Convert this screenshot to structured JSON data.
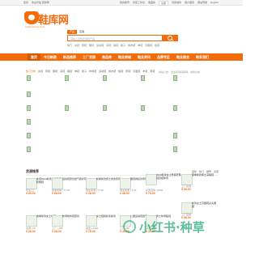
{
  "topbar": {
    "left": [
      "您好",
      "欢迎光临 鞋库网"
    ],
    "right": [
      "我的账号",
      "商家工作台",
      "收藏夹",
      "切换城市",
      "客户服务",
      "网站导航",
      "English"
    ],
    "location": "全国"
  },
  "logo": {
    "name": "鞋库网",
    "sub": "xiekuwang.com"
  },
  "search": {
    "tabs": [
      "产品",
      "店铺"
    ],
    "active_tab": 0,
    "placeholder": "请输入您想搜索的产品",
    "hot": [
      "热门",
      "女鞋",
      "男鞋",
      "童鞋",
      "运动鞋",
      "凉鞋",
      "拖鞋",
      "靴子",
      "帆布鞋",
      "单鞋",
      "高跟鞋",
      "板鞋"
    ]
  },
  "nav": {
    "items": [
      "首页",
      "今日新款",
      "新品推荐",
      "工厂货源",
      "商品库",
      "鞋业商城",
      "鞋业资讯",
      "品牌专区",
      "鞋业展会",
      "联系我们"
    ],
    "active": 0
  },
  "catbar": {
    "items": [
      "热门分类",
      "女鞋",
      "男鞋",
      "童鞋",
      "凉鞋",
      "拖鞋",
      "单鞋",
      "靴子",
      "休闲鞋",
      "运动鞋",
      "帆布鞋",
      "板鞋",
      "皮鞋",
      "高跟鞋",
      "布鞋",
      "雨鞋"
    ],
    "notice": "本站公告：欢迎来到鞋库网，诚信为本"
  },
  "section": {
    "title": "货源推荐",
    "tabs": [
      "最新",
      "热门",
      "推荐",
      "全部"
    ]
  },
  "products": [
    {
      "title": "女鞋2024新款春季厚底松糕鞋",
      "seller": "鞋业工厂",
      "price": "¥ 35.00"
    },
    {
      "title": "运动鞋男款透气跑步鞋",
      "seller": "批发商城 | 77.00",
      "price": "¥ 68.00"
    },
    {
      "title": "秋季新款男士商务皮鞋",
      "seller": "鞋业货源 | 77.00",
      "price": "¥ 48.00"
    },
    {
      "title": "童鞋春秋款男童运动鞋",
      "seller": "鞋业批发 | 1.20",
      "price": "¥ 48.00"
    },
    {
      "title": "2024新款女士厚底老爹鞋百搭休闲",
      "seller": "货源直供 | 2000",
      "price": "¥ 75.00"
    },
    {
      "title": "夏季新款男士凉拖鞋",
      "seller": "工厂货源",
      "price": "¥ 28.00"
    },
    {
      "title": "新款女士高跟鞋尖头细跟",
      "seller": "工厂直销",
      "price": "¥ 58.00"
    }
  ],
  "bottom_products": [
    {
      "title": "春季新款女士单鞋",
      "seller": "货源 | 90",
      "price": "¥ 36.00"
    },
    {
      "title": "休闲帆布鞋男款",
      "seller": "工厂 | 188",
      "price": "¥ 38.00"
    },
    {
      "title": "女士短靴秋冬新款",
      "seller": "批发 | 1922",
      "price": "¥ 78.00"
    },
    {
      "title": "儿童运动鞋透气",
      "seller": "工厂 | 88",
      "price": "¥ 40.00"
    },
    {
      "title": "男士休闲板鞋",
      "seller": "货源 | 120",
      "price": "¥ 45.00"
    }
  ],
  "watermark": "小红书·种草"
}
